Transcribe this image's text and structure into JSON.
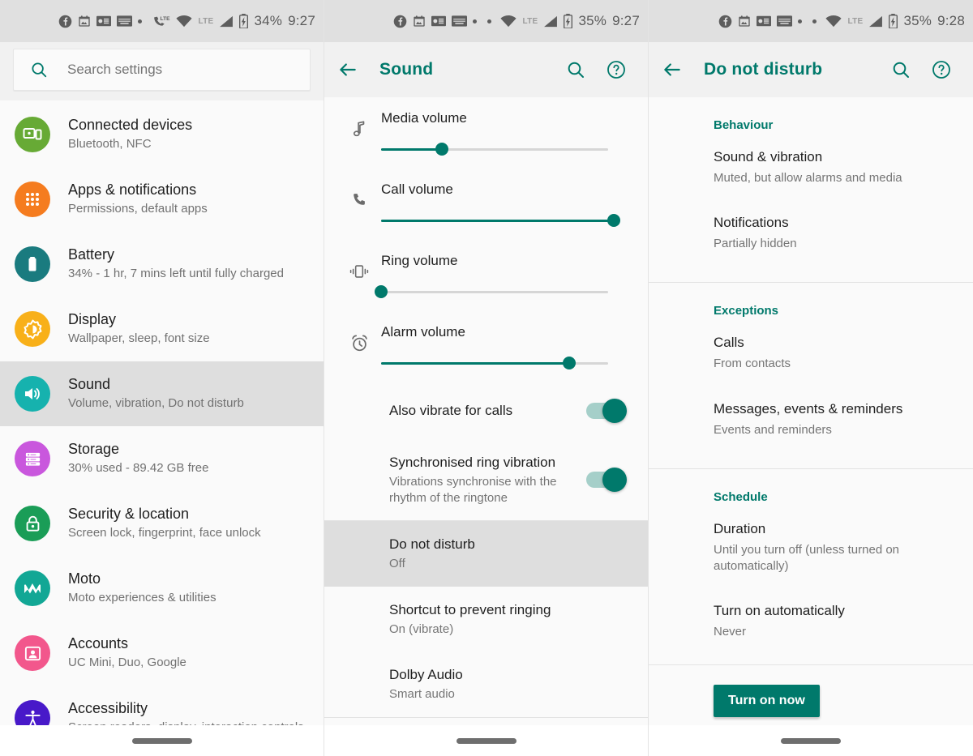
{
  "statusbars": [
    {
      "icons": [
        "facebook-icon",
        "calendar-icon",
        "news-icon",
        "keyboard-icon",
        "dot",
        "missed-call-lte-icon",
        "wifi-icon",
        "lte-label",
        "signal-icon",
        "battery-icon"
      ],
      "lte_label": "LTE",
      "battery": "34%",
      "time": "9:27"
    },
    {
      "icons": [
        "facebook-icon",
        "calendar-icon",
        "news-icon",
        "keyboard-icon",
        "dot",
        "dot",
        "wifi-icon",
        "lte-label",
        "signal-icon",
        "battery-icon"
      ],
      "lte_label": "LTE",
      "battery": "35%",
      "time": "9:27"
    },
    {
      "icons": [
        "facebook-icon",
        "calendar-icon",
        "news-icon",
        "keyboard-icon",
        "dot",
        "dot",
        "wifi-icon",
        "lte-label",
        "signal-icon",
        "battery-icon"
      ],
      "lte_label": "LTE",
      "battery": "35%",
      "time": "9:28"
    }
  ],
  "colors": {
    "accent": "#00796b",
    "statusbar_bg": "#e0e0e0",
    "panel_bg": "#fafafa",
    "selected_row": "#dedede",
    "appbar_bg": "#f1f1f1"
  },
  "settings": {
    "search": {
      "placeholder": "Search settings",
      "icon": "search-icon"
    },
    "items": [
      {
        "title": "Connected devices",
        "subtitle": "Bluetooth, NFC",
        "icon": "devices-icon",
        "color": "#67aa35",
        "selected": false
      },
      {
        "title": "Apps & notifications",
        "subtitle": "Permissions, default apps",
        "icon": "apps-grid-icon",
        "color": "#f57c1f",
        "selected": false
      },
      {
        "title": "Battery",
        "subtitle": "34% - 1 hr, 7 mins left until fully charged",
        "icon": "battery-icon",
        "color": "#1a7b7f",
        "selected": false
      },
      {
        "title": "Display",
        "subtitle": "Wallpaper, sleep, font size",
        "icon": "brightness-icon",
        "color": "#f8b019",
        "selected": false
      },
      {
        "title": "Sound",
        "subtitle": "Volume, vibration, Do not disturb",
        "icon": "speaker-icon",
        "color": "#16b2ae",
        "selected": true
      },
      {
        "title": "Storage",
        "subtitle": "30% used - 89.42 GB free",
        "icon": "storage-icon",
        "color": "#c957dd",
        "selected": false
      },
      {
        "title": "Security & location",
        "subtitle": "Screen lock, fingerprint, face unlock",
        "icon": "lock-icon",
        "color": "#1a9d57",
        "selected": false
      },
      {
        "title": "Moto",
        "subtitle": "Moto experiences & utilities",
        "icon": "moto-icon",
        "color": "#12a795",
        "selected": false
      },
      {
        "title": "Accounts",
        "subtitle": "UC Mini, Duo, Google",
        "icon": "account-icon",
        "color": "#f2578c",
        "selected": false
      },
      {
        "title": "Accessibility",
        "subtitle": "Screen readers, display, interaction controls",
        "icon": "accessibility-icon",
        "color": "#4819c9",
        "selected": false
      }
    ]
  },
  "sound": {
    "appbar": {
      "title": "Sound",
      "back_icon": "back-arrow-icon",
      "search_icon": "search-icon",
      "help_icon": "help-circle-icon"
    },
    "volumes": [
      {
        "label": "Media volume",
        "icon": "music-note-icon",
        "value": 27,
        "track_width": 280
      },
      {
        "label": "Call volume",
        "icon": "phone-icon",
        "value": 100,
        "track_width": 287
      },
      {
        "label": "Ring volume",
        "icon": "vibrate-icon",
        "value": 0,
        "track_width": 280
      },
      {
        "label": "Alarm volume",
        "icon": "alarm-icon",
        "value": 83,
        "track_width": 280
      }
    ],
    "toggles": [
      {
        "title": "Also vibrate for calls",
        "subtitle": "",
        "state": "on"
      },
      {
        "title": "Synchronised ring vibration",
        "subtitle": "Vibrations synchronise with the rhythm of the ringtone",
        "state": "on"
      }
    ],
    "rows": [
      {
        "title": "Do not disturb",
        "subtitle": "Off",
        "selected": true
      },
      {
        "title": "Shortcut to prevent ringing",
        "subtitle": "On (vibrate)",
        "selected": false
      },
      {
        "title": "Dolby Audio",
        "subtitle": "Smart audio",
        "selected": false
      }
    ]
  },
  "dnd": {
    "appbar": {
      "title": "Do not disturb",
      "back_icon": "back-arrow-icon",
      "search_icon": "search-icon",
      "help_icon": "help-circle-icon"
    },
    "sections": [
      {
        "header": "Behaviour",
        "rows": [
          {
            "title": "Sound & vibration",
            "subtitle": "Muted, but allow alarms and media"
          },
          {
            "title": "Notifications",
            "subtitle": "Partially hidden"
          }
        ]
      },
      {
        "header": "Exceptions",
        "rows": [
          {
            "title": "Calls",
            "subtitle": "From contacts"
          },
          {
            "title": "Messages, events & reminders",
            "subtitle": "Events and reminders"
          }
        ]
      },
      {
        "header": "Schedule",
        "rows": [
          {
            "title": "Duration",
            "subtitle": "Until you turn off (unless turned on automatically)"
          },
          {
            "title": "Turn on automatically",
            "subtitle": "Never"
          }
        ]
      }
    ],
    "turn_on_button": "Turn on now"
  }
}
